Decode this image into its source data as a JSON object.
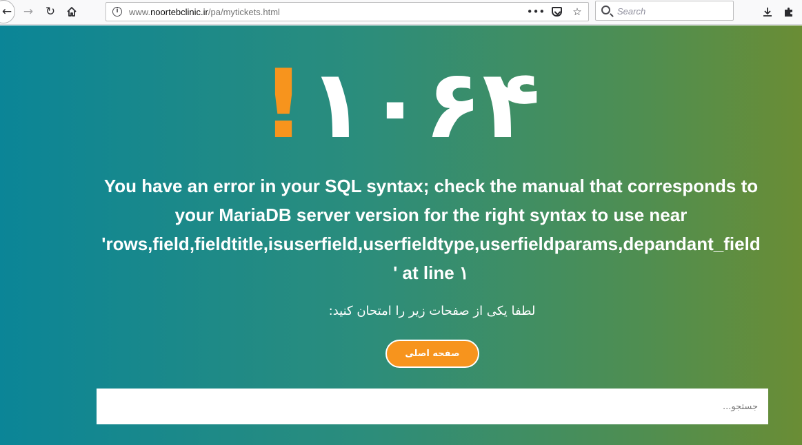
{
  "browser": {
    "url_prefix": "www.",
    "url_host": "noortebclinic.ir",
    "url_path": "/pa/mytickets.html",
    "page_actions_label": "•••",
    "search_placeholder": "Search"
  },
  "page": {
    "error_code": "١٠۶۴",
    "error_mark": "!",
    "error_message": "You have an error in your SQL syntax; check the manual that corresponds to your MariaDB server version for the right syntax to use near",
    "error_query": "'rows,field,fieldtitle,isuserfield,userfieldtype,userfieldparams,depandant_field",
    "error_tail": "' at line ١",
    "hint_text": "لطفا یکی از صفحات زیر را امتحان کنید:",
    "home_button_label": "صفحه اصلی",
    "search_placeholder": "جستجو..."
  },
  "colors": {
    "accent": "#f7941d",
    "gradient_start": "#0b8597",
    "gradient_end": "#6a8d35"
  }
}
